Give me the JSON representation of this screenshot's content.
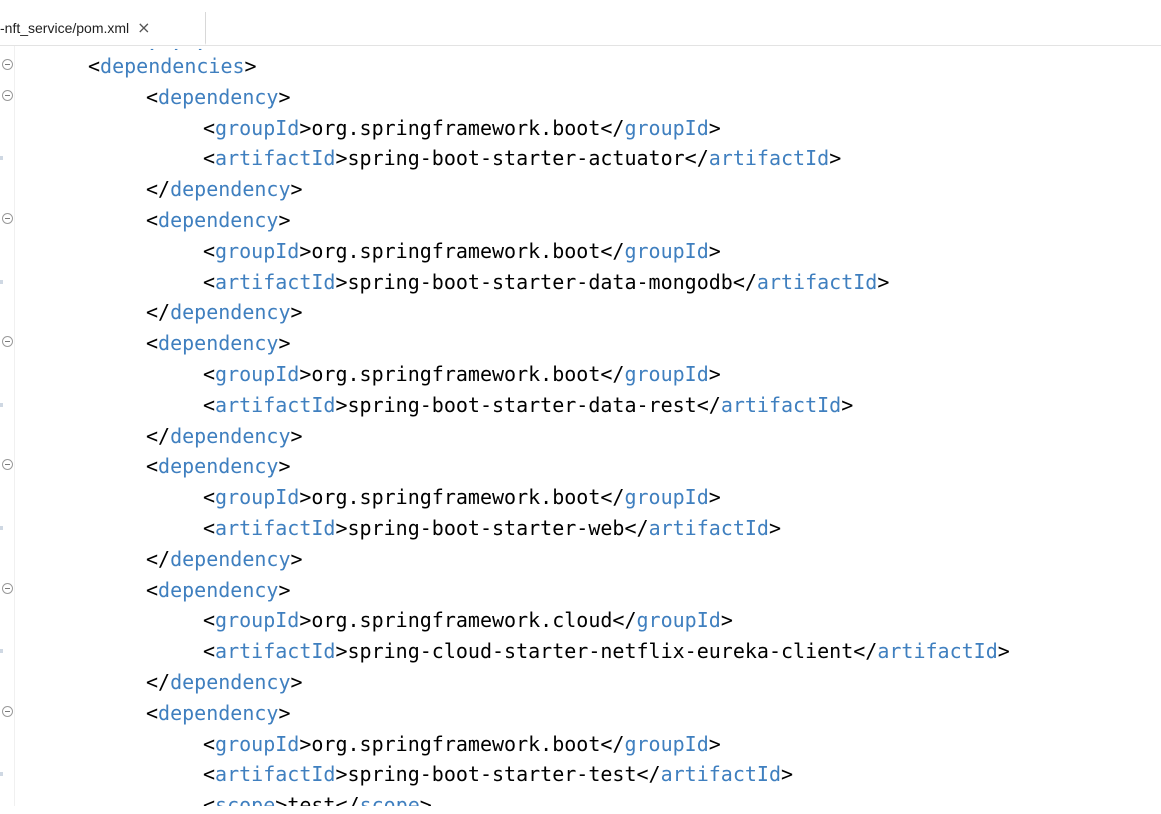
{
  "tab": {
    "label": "-nft_service/pom.xml",
    "close_label": "×"
  },
  "lines": [
    {
      "indent": 0,
      "kind": "open",
      "tag": "dependencies",
      "fold": true
    },
    {
      "indent": 1,
      "kind": "open",
      "tag": "dependency",
      "fold": true
    },
    {
      "indent": 2,
      "kind": "elem",
      "tag": "groupId",
      "text": "org.springframework.boot"
    },
    {
      "indent": 2,
      "kind": "elem",
      "tag": "artifactId",
      "text": "spring-boot-starter-actuator"
    },
    {
      "indent": 1,
      "kind": "close",
      "tag": "dependency"
    },
    {
      "indent": 1,
      "kind": "open",
      "tag": "dependency",
      "fold": true
    },
    {
      "indent": 2,
      "kind": "elem",
      "tag": "groupId",
      "text": "org.springframework.boot"
    },
    {
      "indent": 2,
      "kind": "elem",
      "tag": "artifactId",
      "text": "spring-boot-starter-data-mongodb"
    },
    {
      "indent": 1,
      "kind": "close",
      "tag": "dependency"
    },
    {
      "indent": 1,
      "kind": "open",
      "tag": "dependency",
      "fold": true
    },
    {
      "indent": 2,
      "kind": "elem",
      "tag": "groupId",
      "text": "org.springframework.boot"
    },
    {
      "indent": 2,
      "kind": "elem",
      "tag": "artifactId",
      "text": "spring-boot-starter-data-rest"
    },
    {
      "indent": 1,
      "kind": "close",
      "tag": "dependency"
    },
    {
      "indent": 1,
      "kind": "open",
      "tag": "dependency",
      "fold": true
    },
    {
      "indent": 2,
      "kind": "elem",
      "tag": "groupId",
      "text": "org.springframework.boot"
    },
    {
      "indent": 2,
      "kind": "elem",
      "tag": "artifactId",
      "text": "spring-boot-starter-web"
    },
    {
      "indent": 1,
      "kind": "close",
      "tag": "dependency"
    },
    {
      "indent": 1,
      "kind": "open",
      "tag": "dependency",
      "fold": true
    },
    {
      "indent": 2,
      "kind": "elem",
      "tag": "groupId",
      "text": "org.springframework.cloud"
    },
    {
      "indent": 2,
      "kind": "elem",
      "tag": "artifactId",
      "text": "spring-cloud-starter-netflix-eureka-client"
    },
    {
      "indent": 1,
      "kind": "close",
      "tag": "dependency"
    },
    {
      "indent": 1,
      "kind": "open",
      "tag": "dependency",
      "fold": true
    },
    {
      "indent": 2,
      "kind": "elem",
      "tag": "groupId",
      "text": "org.springframework.boot"
    },
    {
      "indent": 2,
      "kind": "elem",
      "tag": "artifactId",
      "text": "spring-boot-starter-test"
    },
    {
      "indent": 2,
      "kind": "elem",
      "tag": "scope",
      "text": "test"
    }
  ],
  "colors": {
    "tag": "#3f7fbf",
    "text": "#000000",
    "background": "#ffffff"
  },
  "icons": {
    "fold": "collapse-fold-icon",
    "close": "close-icon"
  }
}
